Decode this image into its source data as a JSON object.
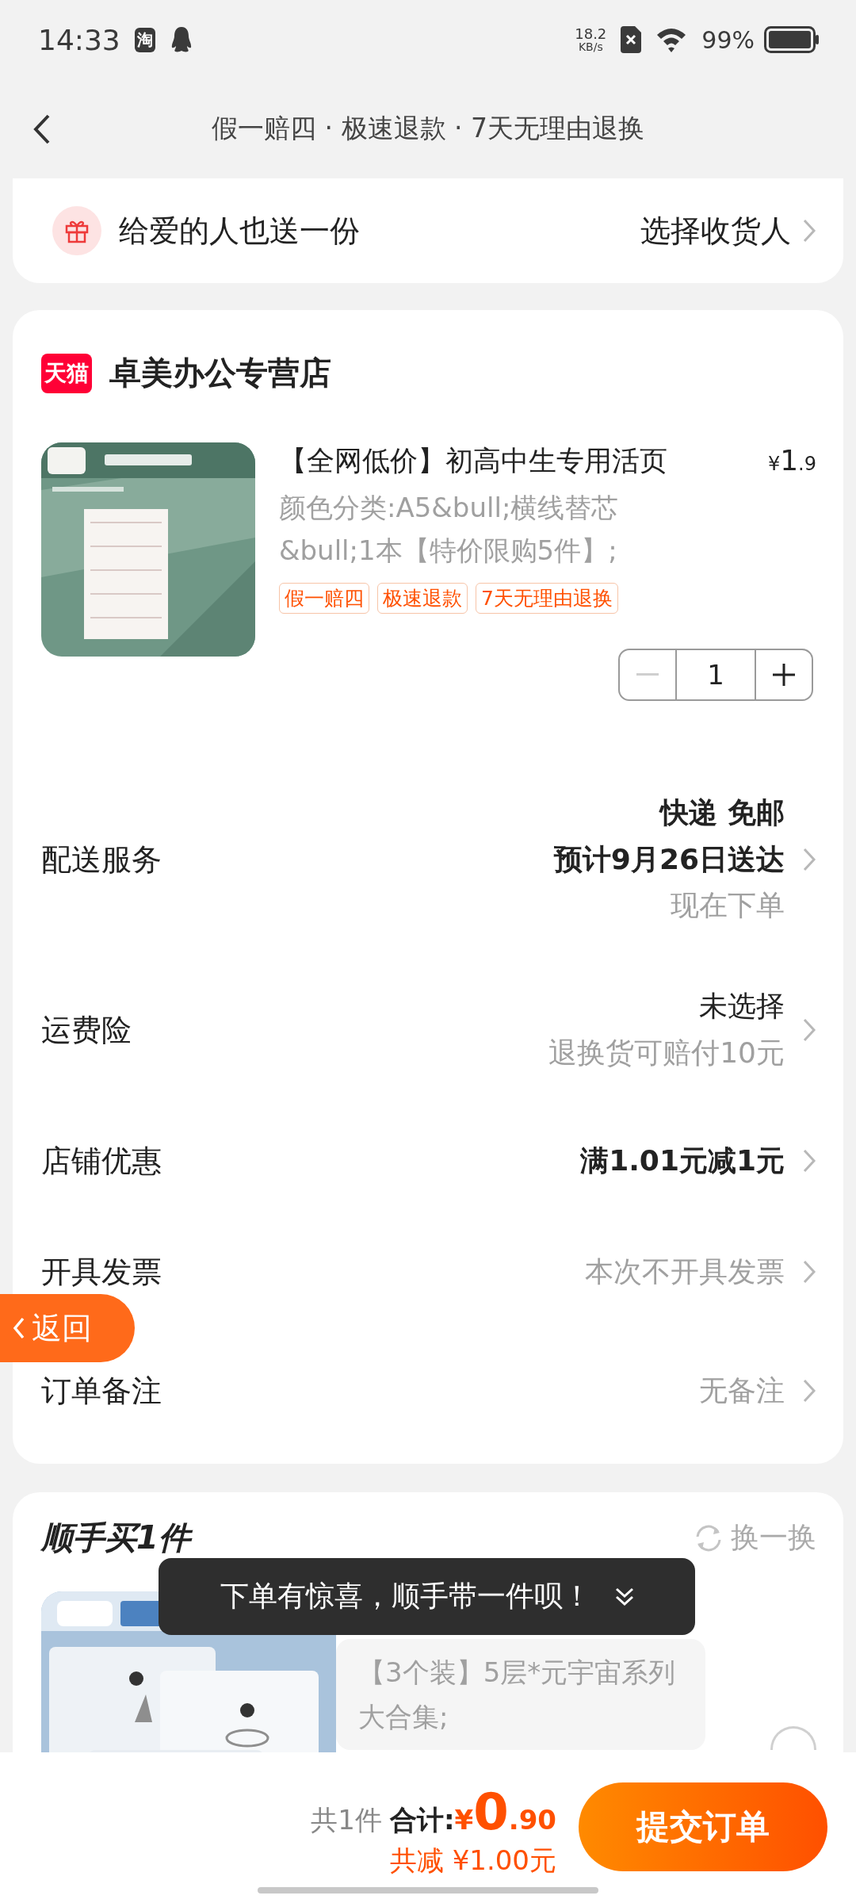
{
  "status_bar": {
    "time": "14:33",
    "app_badge": "淘",
    "speed_value": "18.2",
    "speed_unit": "KB/s",
    "battery": "99%"
  },
  "nav": {
    "title": "假一赔四 · 极速退款 · 7天无理由退换"
  },
  "gift": {
    "label": "给爱的人也送一份",
    "action": "选择收货人"
  },
  "store": {
    "badge": "天猫",
    "name": "卓美办公专营店"
  },
  "product": {
    "title": "【全网低价】初高中生专用活页",
    "currency": "¥",
    "price_int": "1",
    "price_dec": ".9",
    "spec": "颜色分类:A5&bull;横线替芯&bull;1本【特价限购5件】;",
    "tags": [
      "假一赔四",
      "极速退款",
      "7天无理由退换"
    ],
    "quantity": "1",
    "minus_disabled": true
  },
  "rows": [
    {
      "label": "配送服务",
      "lines": [
        {
          "text": "快递 免邮",
          "kind": "strong"
        },
        {
          "text": "预计9月26日送达",
          "kind": "strong"
        },
        {
          "text": "现在下单",
          "kind": "muted"
        }
      ]
    },
    {
      "label": "运费险",
      "lines": [
        {
          "text": "未选择",
          "kind": "normal"
        },
        {
          "text": "退换货可赔付10元",
          "kind": "muted"
        }
      ]
    },
    {
      "label": "店铺优惠",
      "lines": [
        {
          "text": "满1.01元减1元",
          "kind": "strong"
        }
      ]
    },
    {
      "label": "开具发票",
      "lines": [
        {
          "text": "本次不开具发票",
          "kind": "muted"
        }
      ]
    },
    {
      "label": "订单备注",
      "lines": [
        {
          "text": "无备注",
          "kind": "muted"
        }
      ]
    }
  ],
  "back_float": {
    "label": "返回"
  },
  "addon": {
    "title": "顺手买1件",
    "refresh": "换一换",
    "description": "【3个装】5层*元宇宙系列大合集;",
    "selected": false
  },
  "toast": {
    "text": "下单有惊喜，顺手带一件呗！"
  },
  "footer": {
    "count": "共1件",
    "total_label": "合计:",
    "currency": "¥",
    "total_int": "0",
    "total_dec": ".90",
    "savings": "共减 ¥1.00元",
    "submit": "提交订单"
  }
}
